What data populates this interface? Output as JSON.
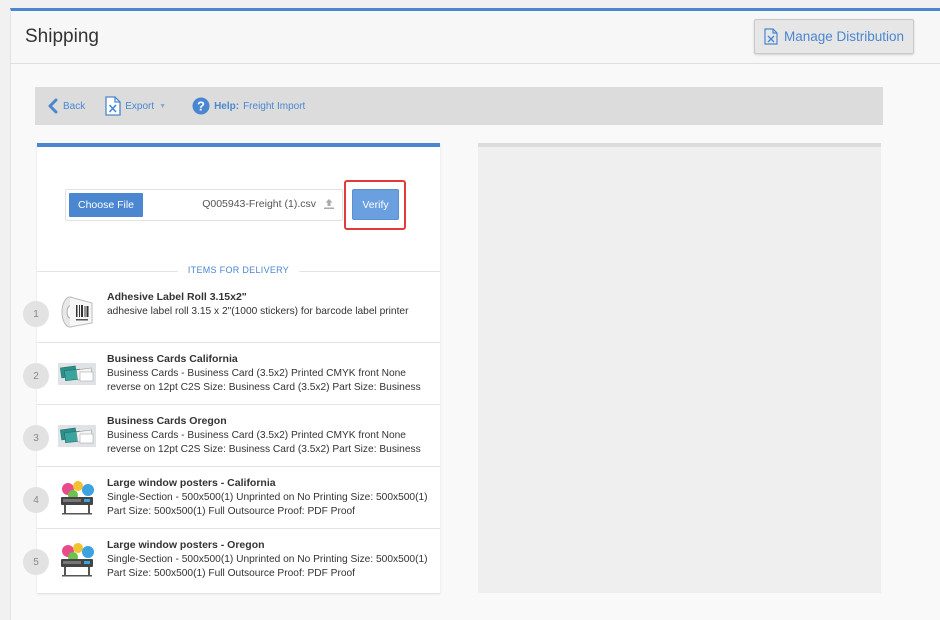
{
  "header": {
    "title": "Shipping",
    "manage_label": "Manage Distribution"
  },
  "toolbar": {
    "back_label": "Back",
    "export_label": "Export",
    "help_prefix": "Help:",
    "help_label": "Freight Import"
  },
  "upload": {
    "choose_label": "Choose File",
    "file_name": "Q005943-Freight (1).csv",
    "verify_label": "Verify"
  },
  "items_section": {
    "heading": "ITEMS FOR DELIVERY",
    "items": [
      {
        "num": "1",
        "title": "Adhesive Label Roll 3.15x2\"",
        "desc": "adhesive label roll 3.15 x 2\"(1000 stickers) for barcode label printer",
        "thumb": "label-roll-icon"
      },
      {
        "num": "2",
        "title": "Business Cards California",
        "desc": "Business Cards - Business Card (3.5x2) Printed CMYK front None reverse on 12pt C2S Size: Business Card (3.5x2) Part Size: Business",
        "thumb": "business-cards-icon"
      },
      {
        "num": "3",
        "title": "Business Cards Oregon",
        "desc": "Business Cards - Business Card (3.5x2) Printed CMYK front None reverse on 12pt C2S Size: Business Card (3.5x2) Part Size: Business",
        "thumb": "business-cards-icon"
      },
      {
        "num": "4",
        "title": "Large window posters - California",
        "desc": "Single-Section - 500x500(1) Unprinted on No Printing Size: 500x500(1) Part Size: 500x500(1) Full Outsource Proof: PDF Proof",
        "thumb": "large-printer-icon"
      },
      {
        "num": "5",
        "title": "Large window posters - Oregon",
        "desc": "Single-Section - 500x500(1) Unprinted on No Printing Size: 500x500(1) Part Size: 500x500(1) Full Outsource Proof: PDF Proof",
        "thumb": "large-printer-icon"
      }
    ]
  },
  "colors": {
    "accent": "#4a87d0",
    "highlight": "#e03a3a"
  }
}
